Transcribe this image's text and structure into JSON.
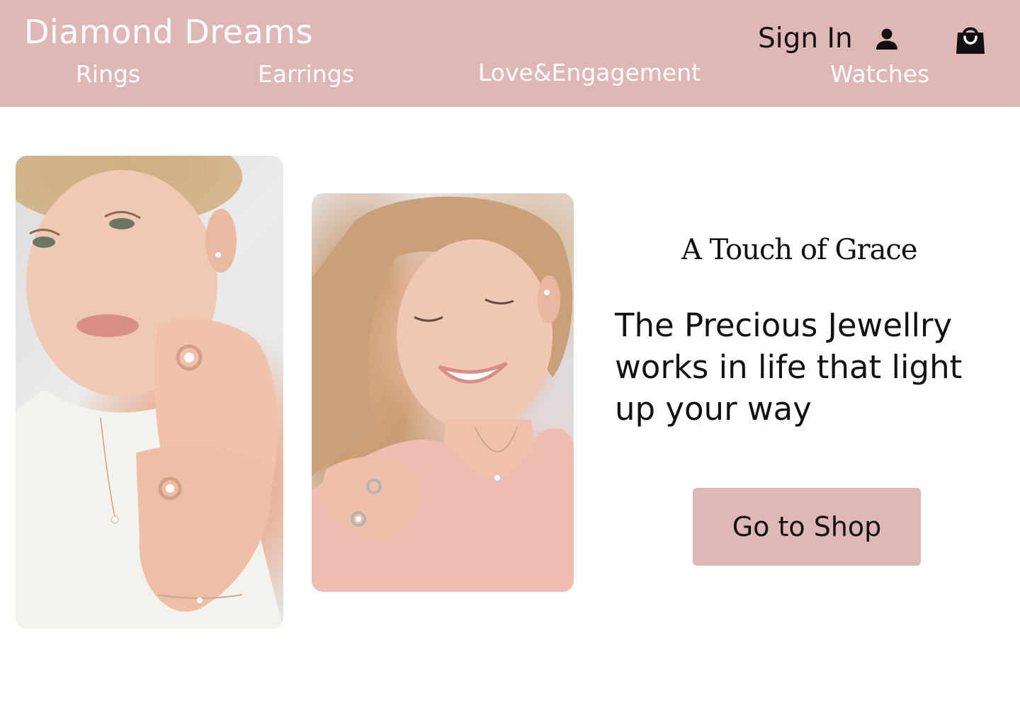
{
  "header": {
    "brand": "Diamond Dreams",
    "nav": [
      {
        "label": "Rings"
      },
      {
        "label": "Earrings"
      },
      {
        "label": "Love&Engagement"
      },
      {
        "label": "Watches"
      }
    ],
    "sign_in_label": "Sign In",
    "user_icon": "user-icon",
    "cart_icon": "shopping-bag-icon"
  },
  "hero": {
    "images": [
      {
        "alt": "model-with-rings-photo"
      },
      {
        "alt": "model-smiling-photo"
      }
    ],
    "tagline": "A Touch of Grace",
    "headline": "The Precious Jewellry works in life that light up your way",
    "cta_label": "Go to Shop"
  },
  "colors": {
    "accent": "#dfb8b6",
    "text": "#111111",
    "header_text": "#ffffff",
    "background": "#ffffff"
  }
}
